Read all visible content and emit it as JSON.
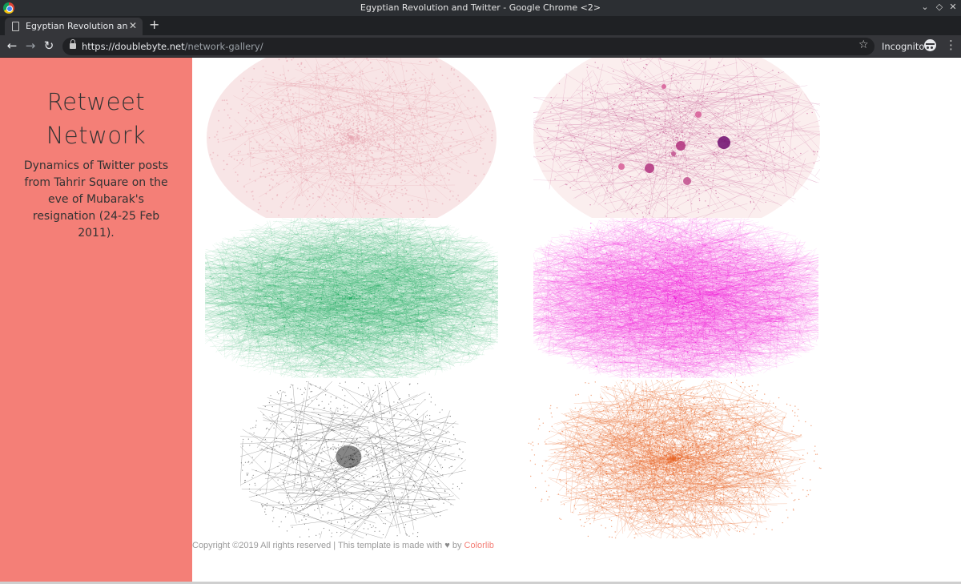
{
  "window": {
    "title": "Egyptian Revolution and Twitter - Google Chrome <2>"
  },
  "tab": {
    "label": "Egyptian Revolution and Twitter"
  },
  "toolbar": {
    "url_host": "https://doublebyte.net",
    "url_path": "/network-gallery/",
    "incognito_label": "Incognito"
  },
  "sidebar": {
    "title": "Retweet Network",
    "description": "Dynamics of Twitter posts from Tahrir Square on the eve of Mubarak's resignation (24-25 Feb 2011)."
  },
  "gallery": {
    "items": [
      {
        "name": "network-pink-graph",
        "color": "#e7a7b2",
        "background": "#f8e5e6"
      },
      {
        "name": "network-purple-bubbles-graph",
        "color": "#c04c8c",
        "background": "#fbeeee"
      },
      {
        "name": "network-green-graph",
        "color": "#06a04f",
        "background": "#ffffff"
      },
      {
        "name": "network-magenta-graph",
        "color": "#f000d8",
        "background": "#ffffff"
      },
      {
        "name": "network-grey-graph",
        "color": "#333333",
        "background": "#ffffff"
      },
      {
        "name": "network-orange-graph",
        "color": "#e8682a",
        "background": "#ffffff"
      }
    ]
  },
  "footer": {
    "text": "Copyright ©2019 All rights reserved | This template is made with",
    "by": "by",
    "link": "Colorlib"
  }
}
